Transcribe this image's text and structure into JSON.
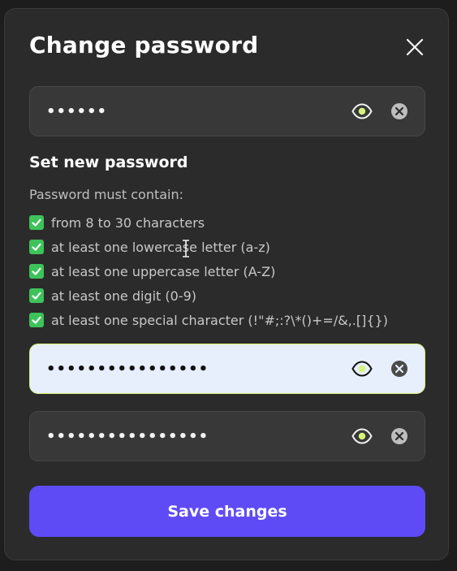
{
  "dialog": {
    "title": "Change password",
    "current_password": {
      "value": "••••••"
    },
    "section_title": "Set new password",
    "requirements_hint": "Password must contain:",
    "requirements": [
      {
        "label": "from 8 to 30 characters",
        "met": true
      },
      {
        "label": "at least one lowercase letter (a-z)",
        "met": true
      },
      {
        "label": "at least one uppercase letter (A-Z)",
        "met": true
      },
      {
        "label": "at least one digit (0-9)",
        "met": true
      },
      {
        "label": "at least one special character (!\"#;:?\\*()+=/&,.[]{})",
        "met": true
      }
    ],
    "new_password": {
      "value": "••••••••••••••••"
    },
    "confirm_password": {
      "value": "••••••••••••••••"
    },
    "save_label": "Save changes",
    "icons": {
      "close": "close-icon",
      "eye": "eye-icon",
      "clear": "clear-icon",
      "check": "checkbox-check-icon"
    },
    "colors": {
      "accent": "#5f4bf5",
      "check": "#3ec25a",
      "active_border": "#d7f27a",
      "eye_dot": "#d7f27a"
    }
  }
}
